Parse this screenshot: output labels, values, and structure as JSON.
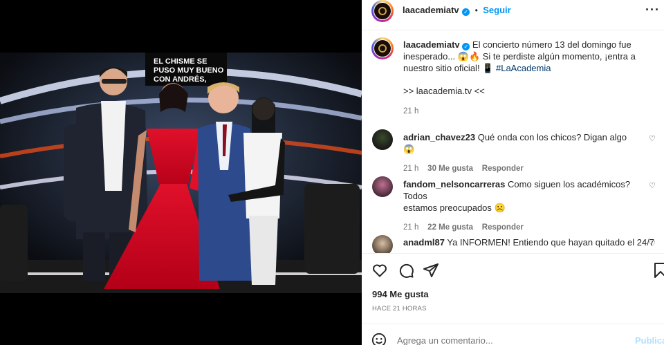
{
  "post": {
    "overlay_text": [
      "EL CHISME SE",
      "PUSO MUY BUENO",
      "CON ANDRÉS,"
    ]
  },
  "header": {
    "username": "laacademiatv",
    "dot": "•",
    "follow_label": "Seguir",
    "more_icon": "more-horizontal-icon"
  },
  "caption": {
    "username": "laacademiatv",
    "text_1": "El concierto número 13 del domingo fue",
    "text_2": "inesperado... 😱🔥 Si te perdiste algún momento, ¡entra a",
    "text_3": "nuestro sitio oficial! 📱",
    "hashtag": "#LaAcademia",
    "link_line": ">> laacademia.tv <<",
    "time": "21 h"
  },
  "comments": [
    {
      "username": "adrian_chavez23",
      "text": "Qué onda con los chicos? Digan algo 😱",
      "time": "21 h",
      "likes": "30 Me gusta",
      "reply": "Responder"
    },
    {
      "username": "fandom_nelsoncarreras",
      "text_1": "Como siguen los académicos? Todos",
      "text_2": "estamos preocupados ☹️",
      "time": "21 h",
      "likes": "22 Me gusta",
      "reply": "Responder"
    },
    {
      "username": "anadml87",
      "text": "Ya INFORMEN! Entiendo que hayan quitado el 24/7"
    }
  ],
  "actions": {
    "likes": "994 Me gusta",
    "timestamp": "HACE 21 HORAS",
    "comment_placeholder": "Agrega un comentario...",
    "publish_label": "Publica",
    "icons": [
      "heart-icon",
      "comment-icon",
      "share-icon",
      "bookmark-icon",
      "emoji-icon"
    ]
  },
  "colors": {
    "link": "#0095f6",
    "verified": "#0095f6",
    "dress": "#e0102a"
  }
}
